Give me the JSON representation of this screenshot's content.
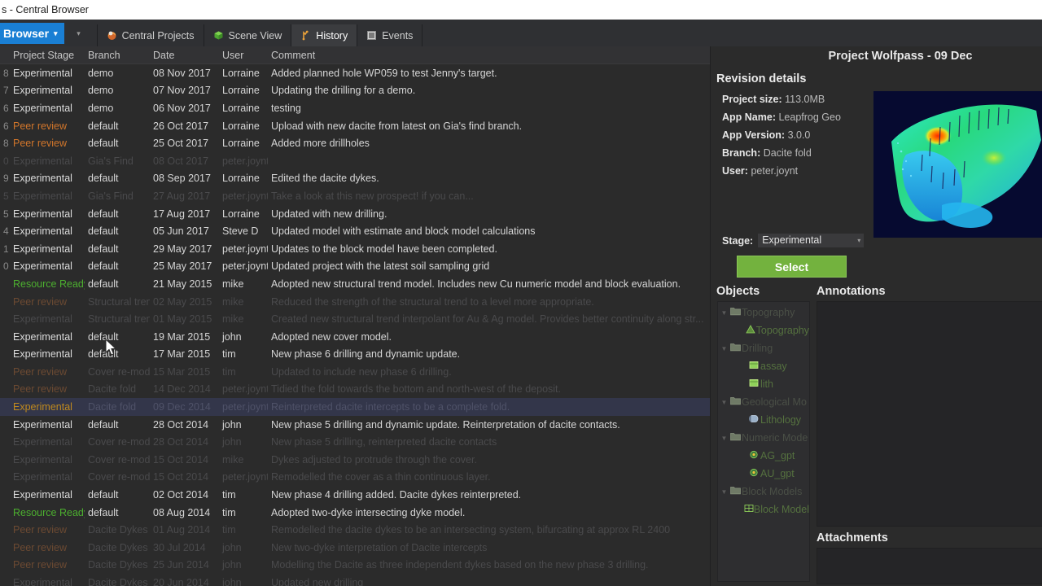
{
  "window": {
    "title": "s - Central Browser"
  },
  "menubar": {
    "browser_label": "Browser",
    "browser_caret": "▾",
    "overflow_caret": "▾",
    "tabs": [
      {
        "label": "Central Projects",
        "icon": "central-projects-icon",
        "active": false
      },
      {
        "label": "Scene View",
        "icon": "scene-view-icon",
        "active": false
      },
      {
        "label": "History",
        "icon": "history-icon",
        "active": true
      },
      {
        "label": "Events",
        "icon": "events-icon",
        "active": false
      }
    ]
  },
  "table": {
    "columns": [
      "",
      "Project Stage",
      "Branch",
      "Date",
      "User",
      "Comment"
    ],
    "rows": [
      {
        "rev": "8",
        "stage": "Experimental",
        "stage_kind": "exp",
        "branch": "demo",
        "date": "08 Nov 2017",
        "user": "Lorraine",
        "comment": "Added planned hole WP059 to test Jenny's target.",
        "dim": false,
        "selected": false
      },
      {
        "rev": "7",
        "stage": "Experimental",
        "stage_kind": "exp",
        "branch": "demo",
        "date": "07 Nov 2017",
        "user": "Lorraine",
        "comment": "Updating the drilling for a demo.",
        "dim": false,
        "selected": false
      },
      {
        "rev": "6",
        "stage": "Experimental",
        "stage_kind": "exp",
        "branch": "demo",
        "date": "06 Nov 2017",
        "user": "Lorraine",
        "comment": "testing",
        "dim": false,
        "selected": false
      },
      {
        "rev": "6",
        "stage": "Peer review",
        "stage_kind": "peer",
        "branch": "default",
        "date": "26 Oct 2017",
        "user": "Lorraine",
        "comment": "Upload with new dacite from latest on Gia's find branch.",
        "dim": false,
        "selected": false
      },
      {
        "rev": "8",
        "stage": "Peer review",
        "stage_kind": "peer",
        "branch": "default",
        "date": "25 Oct 2017",
        "user": "Lorraine",
        "comment": "Added more drillholes",
        "dim": false,
        "selected": false
      },
      {
        "rev": "0",
        "stage": "Experimental",
        "stage_kind": "exp",
        "branch": "Gia's Find",
        "date": "08 Oct 2017",
        "user": "peter.joynt",
        "comment": "",
        "dim": true,
        "selected": false
      },
      {
        "rev": "9",
        "stage": "Experimental",
        "stage_kind": "exp",
        "branch": "default",
        "date": "08 Sep 2017",
        "user": "Lorraine",
        "comment": "Edited the dacite dykes.",
        "dim": false,
        "selected": false
      },
      {
        "rev": "5",
        "stage": "Experimental",
        "stage_kind": "exp",
        "branch": "Gia's Find",
        "date": "27 Aug 2017",
        "user": "peter.joynt",
        "comment": "Take a look at this new prospect! if you can...",
        "dim": true,
        "selected": false
      },
      {
        "rev": "5",
        "stage": "Experimental",
        "stage_kind": "exp",
        "branch": "default",
        "date": "17 Aug 2017",
        "user": "Lorraine",
        "comment": "Updated with new drilling.",
        "dim": false,
        "selected": false
      },
      {
        "rev": "4",
        "stage": "Experimental",
        "stage_kind": "exp",
        "branch": "default",
        "date": "05 Jun 2017",
        "user": "Steve D",
        "comment": "Updated model with estimate and block model calculations",
        "dim": false,
        "selected": false
      },
      {
        "rev": "1",
        "stage": "Experimental",
        "stage_kind": "exp",
        "branch": "default",
        "date": "29 May 2017",
        "user": "peter.joynt",
        "comment": "Updates to the block model have been completed.",
        "dim": false,
        "selected": false
      },
      {
        "rev": "0",
        "stage": "Experimental",
        "stage_kind": "exp",
        "branch": "default",
        "date": "25 May 2017",
        "user": "peter.joynt",
        "comment": "Updated project with the latest soil sampling grid",
        "dim": false,
        "selected": false
      },
      {
        "rev": "",
        "stage": "Resource Ready",
        "stage_kind": "res",
        "branch": "default",
        "date": "21 May 2015",
        "user": "mike",
        "comment": "Adopted new structural trend model.  Includes new Cu numeric model and block evaluation.",
        "dim": false,
        "selected": false
      },
      {
        "rev": "",
        "stage": "Peer review",
        "stage_kind": "peer",
        "branch": "Structural tren",
        "date": "02 May 2015",
        "user": "mike",
        "comment": "Reduced the strength of the structural trend to a level more appropriate.",
        "dim": true,
        "selected": false
      },
      {
        "rev": "",
        "stage": "Experimental",
        "stage_kind": "exp",
        "branch": "Structural tren",
        "date": "01 May 2015",
        "user": "mike",
        "comment": "Created new structural trend interpolant for Au & Ag model.  Provides better continuity along str...",
        "dim": true,
        "selected": false
      },
      {
        "rev": "",
        "stage": "Experimental",
        "stage_kind": "exp",
        "branch": "default",
        "date": "19 Mar 2015",
        "user": "john",
        "comment": "Adopted new cover model.",
        "dim": false,
        "selected": false
      },
      {
        "rev": "",
        "stage": "Experimental",
        "stage_kind": "exp",
        "branch": "default",
        "date": "17 Mar 2015",
        "user": "tim",
        "comment": "New phase 6 drilling and dynamic update.",
        "dim": false,
        "selected": false
      },
      {
        "rev": "",
        "stage": "Peer review",
        "stage_kind": "peer",
        "branch": "Cover re-mode",
        "date": "15 Mar 2015",
        "user": "tim",
        "comment": "Updated to include new phase 6 drilling.",
        "dim": true,
        "selected": false
      },
      {
        "rev": "",
        "stage": "Peer review",
        "stage_kind": "peer",
        "branch": "Dacite fold",
        "date": "14 Dec 2014",
        "user": "peter.joynt",
        "comment": "Tidied the fold towards the bottom and north-west of the deposit.",
        "dim": true,
        "selected": false
      },
      {
        "rev": "",
        "stage": "Experimental",
        "stage_kind": "exp",
        "branch": "Dacite fold",
        "date": "09 Dec 2014",
        "user": "peter.joynt",
        "comment": "Reinterpreted dacite intercepts to be a complete fold.",
        "dim": true,
        "selected": true
      },
      {
        "rev": "",
        "stage": "Experimental",
        "stage_kind": "exp",
        "branch": "default",
        "date": "28 Oct 2014",
        "user": "john",
        "comment": "New phase 5 drilling and dynamic update.  Reinterpretation of dacite contacts.",
        "dim": false,
        "selected": false
      },
      {
        "rev": "",
        "stage": "Experimental",
        "stage_kind": "exp",
        "branch": "Cover re-mode",
        "date": "28 Oct 2014",
        "user": "john",
        "comment": "New phase 5 drilling, reinterpreted dacite contacts",
        "dim": true,
        "selected": false
      },
      {
        "rev": "",
        "stage": "Experimental",
        "stage_kind": "exp",
        "branch": "Cover re-mode",
        "date": "15 Oct 2014",
        "user": "mike",
        "comment": "Dykes adjusted to protrude through the cover.",
        "dim": true,
        "selected": false
      },
      {
        "rev": "",
        "stage": "Experimental",
        "stage_kind": "exp",
        "branch": "Cover re-mode",
        "date": "15 Oct 2014",
        "user": "peter.joynt",
        "comment": "Remodelled the cover as a thin continuous layer.",
        "dim": true,
        "selected": false
      },
      {
        "rev": "",
        "stage": "Experimental",
        "stage_kind": "exp",
        "branch": "default",
        "date": "02 Oct 2014",
        "user": "tim",
        "comment": "New phase 4 drilling added.  Dacite dykes reinterpreted.",
        "dim": false,
        "selected": false
      },
      {
        "rev": "",
        "stage": "Resource Ready",
        "stage_kind": "res",
        "branch": "default",
        "date": "08 Aug 2014",
        "user": "tim",
        "comment": "Adopted two-dyke intersecting dyke model.",
        "dim": false,
        "selected": false
      },
      {
        "rev": "",
        "stage": "Peer review",
        "stage_kind": "peer",
        "branch": "Dacite Dykes",
        "date": "01 Aug 2014",
        "user": "tim",
        "comment": "Remodelled the dacite dykes to be an intersecting system, bifurcating at approx RL 2400",
        "dim": true,
        "selected": false
      },
      {
        "rev": "",
        "stage": "Peer review",
        "stage_kind": "peer",
        "branch": "Dacite Dykes",
        "date": "30 Jul 2014",
        "user": "john",
        "comment": "New two-dyke interpretation of Dacite intercepts",
        "dim": true,
        "selected": false
      },
      {
        "rev": "",
        "stage": "Peer review",
        "stage_kind": "peer",
        "branch": "Dacite Dykes",
        "date": "25 Jun 2014",
        "user": "john",
        "comment": "Modelling the Dacite as three independent dykes based on the new phase 3 drilling.",
        "dim": true,
        "selected": false
      },
      {
        "rev": "",
        "stage": "Experimental",
        "stage_kind": "exp",
        "branch": "Dacite Dykes",
        "date": "20 Jun 2014",
        "user": "john",
        "comment": "Updated new drilling",
        "dim": true,
        "selected": false
      }
    ]
  },
  "details": {
    "project_title": "Project Wolfpass - 09 Dec",
    "revision_details_header": "Revision details",
    "meta": [
      {
        "key": "Project size:",
        "value": "113.0MB"
      },
      {
        "key": "App Name:",
        "value": "Leapfrog Geo"
      },
      {
        "key": "App Version:",
        "value": "3.0.0"
      },
      {
        "key": "Branch:",
        "value": "Dacite fold"
      },
      {
        "key": "User:",
        "value": "peter.joynt"
      }
    ],
    "stage_label": "Stage:",
    "stage_value": "Experimental",
    "stage_caret": "▾",
    "select_button": "Select",
    "objects_header": "Objects",
    "annotations_header": "Annotations",
    "attachments_header": "Attachments",
    "objects": [
      {
        "label": "Topography",
        "level": 1,
        "type": "folder",
        "expander": "▼"
      },
      {
        "label": "Topography",
        "level": 2,
        "type": "mesh",
        "expander": ""
      },
      {
        "label": "Drilling",
        "level": 1,
        "type": "folder",
        "expander": "▼"
      },
      {
        "label": "assay",
        "level": 2,
        "type": "table",
        "expander": ""
      },
      {
        "label": "lith",
        "level": 2,
        "type": "table",
        "expander": ""
      },
      {
        "label": "Geological Mo",
        "level": 1,
        "type": "folder",
        "expander": "▼"
      },
      {
        "label": "Lithology",
        "level": 2,
        "type": "geo",
        "expander": ""
      },
      {
        "label": "Numeric Mode",
        "level": 1,
        "type": "folder",
        "expander": "▼"
      },
      {
        "label": "AG_gpt",
        "level": 2,
        "type": "numeric",
        "expander": ""
      },
      {
        "label": "AU_gpt",
        "level": 2,
        "type": "numeric",
        "expander": ""
      },
      {
        "label": "Block Models",
        "level": 1,
        "type": "folder",
        "expander": "▼"
      },
      {
        "label": "Block Model",
        "level": 2,
        "type": "block",
        "expander": ""
      }
    ]
  },
  "colors": {
    "accent_blue": "#1a7fd4",
    "select_green": "#73b23e",
    "stage_peer": "#d2762b",
    "stage_resource": "#4caf2f",
    "selected_row": "#33364a",
    "panel_bg": "#2b2b2b"
  }
}
